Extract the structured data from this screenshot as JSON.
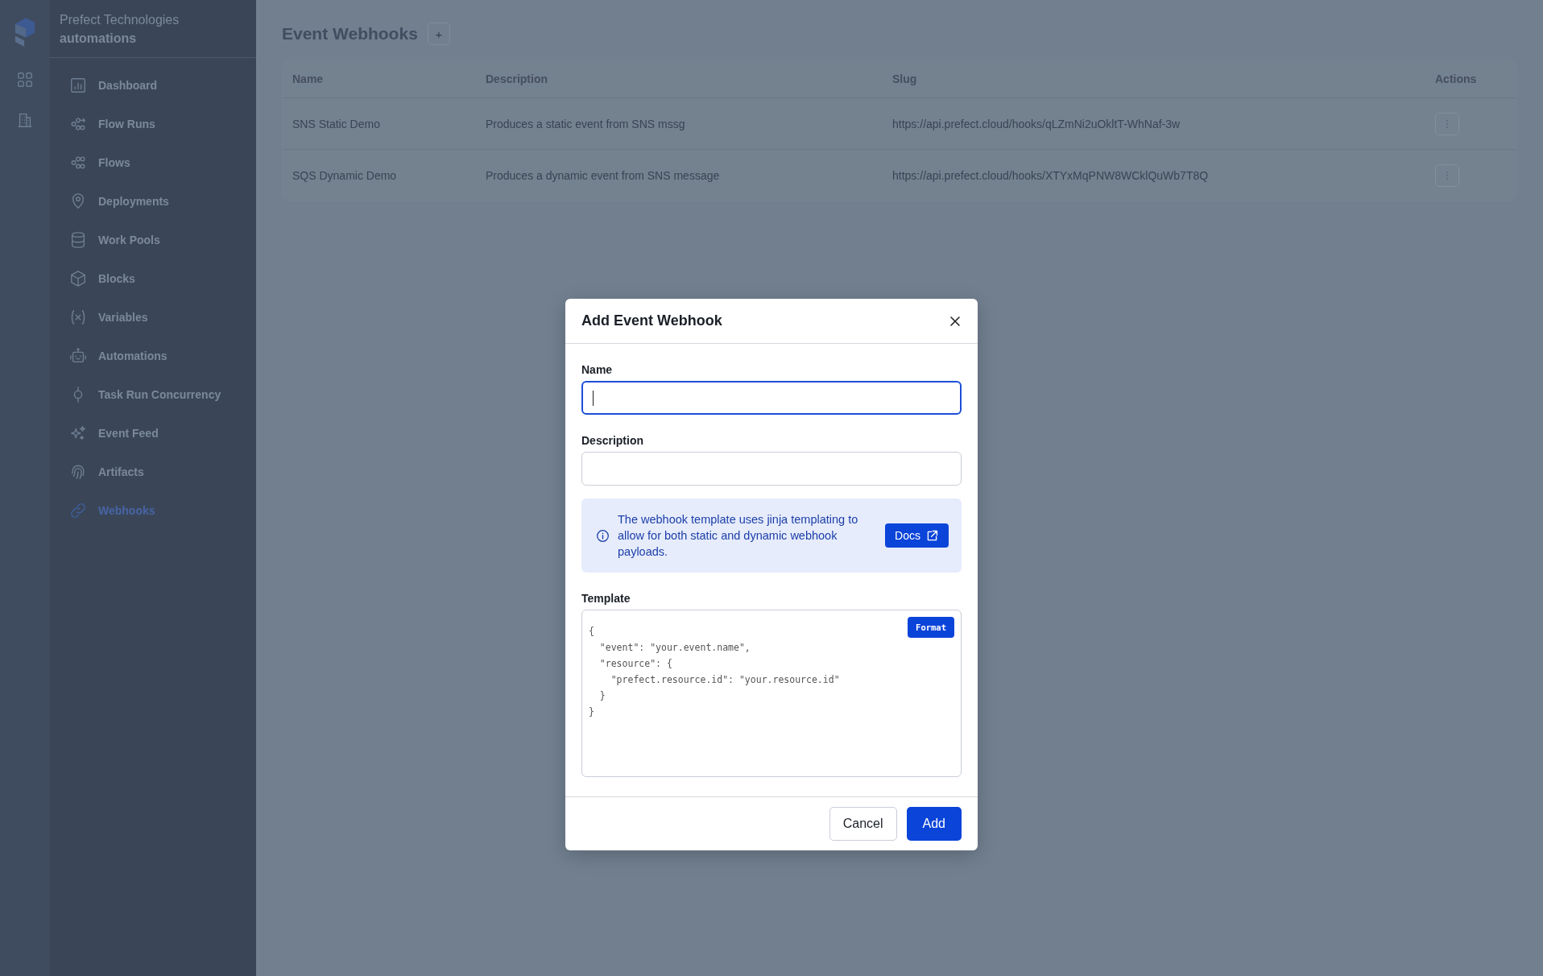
{
  "sidebar": {
    "account": "Prefect Technologies",
    "workspace": "automations",
    "items": [
      {
        "label": "Dashboard",
        "selected": false
      },
      {
        "label": "Flow Runs",
        "selected": false
      },
      {
        "label": "Flows",
        "selected": false
      },
      {
        "label": "Deployments",
        "selected": false
      },
      {
        "label": "Work Pools",
        "selected": false
      },
      {
        "label": "Blocks",
        "selected": false
      },
      {
        "label": "Variables",
        "selected": false
      },
      {
        "label": "Automations",
        "selected": false
      },
      {
        "label": "Task Run Concurrency",
        "selected": false
      },
      {
        "label": "Event Feed",
        "selected": false
      },
      {
        "label": "Artifacts",
        "selected": false
      },
      {
        "label": "Webhooks",
        "selected": true
      }
    ]
  },
  "page": {
    "title": "Event Webhooks",
    "add_button": "+"
  },
  "table": {
    "columns": [
      "Name",
      "Description",
      "Slug",
      "Actions"
    ],
    "rows": [
      {
        "cells": [
          "SNS Static Demo",
          "Produces a static event from SNS mssg",
          "https://api.prefect.cloud/hooks/qLZmNi2uOkltT-WhNaf-3w"
        ]
      },
      {
        "cells": [
          "SQS Dynamic Demo",
          "Produces a dynamic event from SNS message",
          "https://api.prefect.cloud/hooks/XTYxMqPNW8WCklQuWb7T8Q"
        ]
      }
    ]
  },
  "dialog": {
    "title": "Add Event Webhook",
    "name_field": {
      "label": "Name",
      "focused": true
    },
    "description_field": {
      "label": "Description"
    },
    "info": {
      "text": "The webhook template uses jinja templating to allow for both static and dynamic webhook payloads.",
      "button": "Docs"
    },
    "template": {
      "label": "Template",
      "format_button": "Format",
      "lines": [
        "{",
        "  \"event\": \"your.event.name\",",
        "  \"resource\": {",
        "    \"prefect.resource.id\": \"your.resource.id\"",
        "  }",
        "}"
      ]
    },
    "buttons": {
      "cancel": "Cancel",
      "confirm": "Add"
    }
  }
}
